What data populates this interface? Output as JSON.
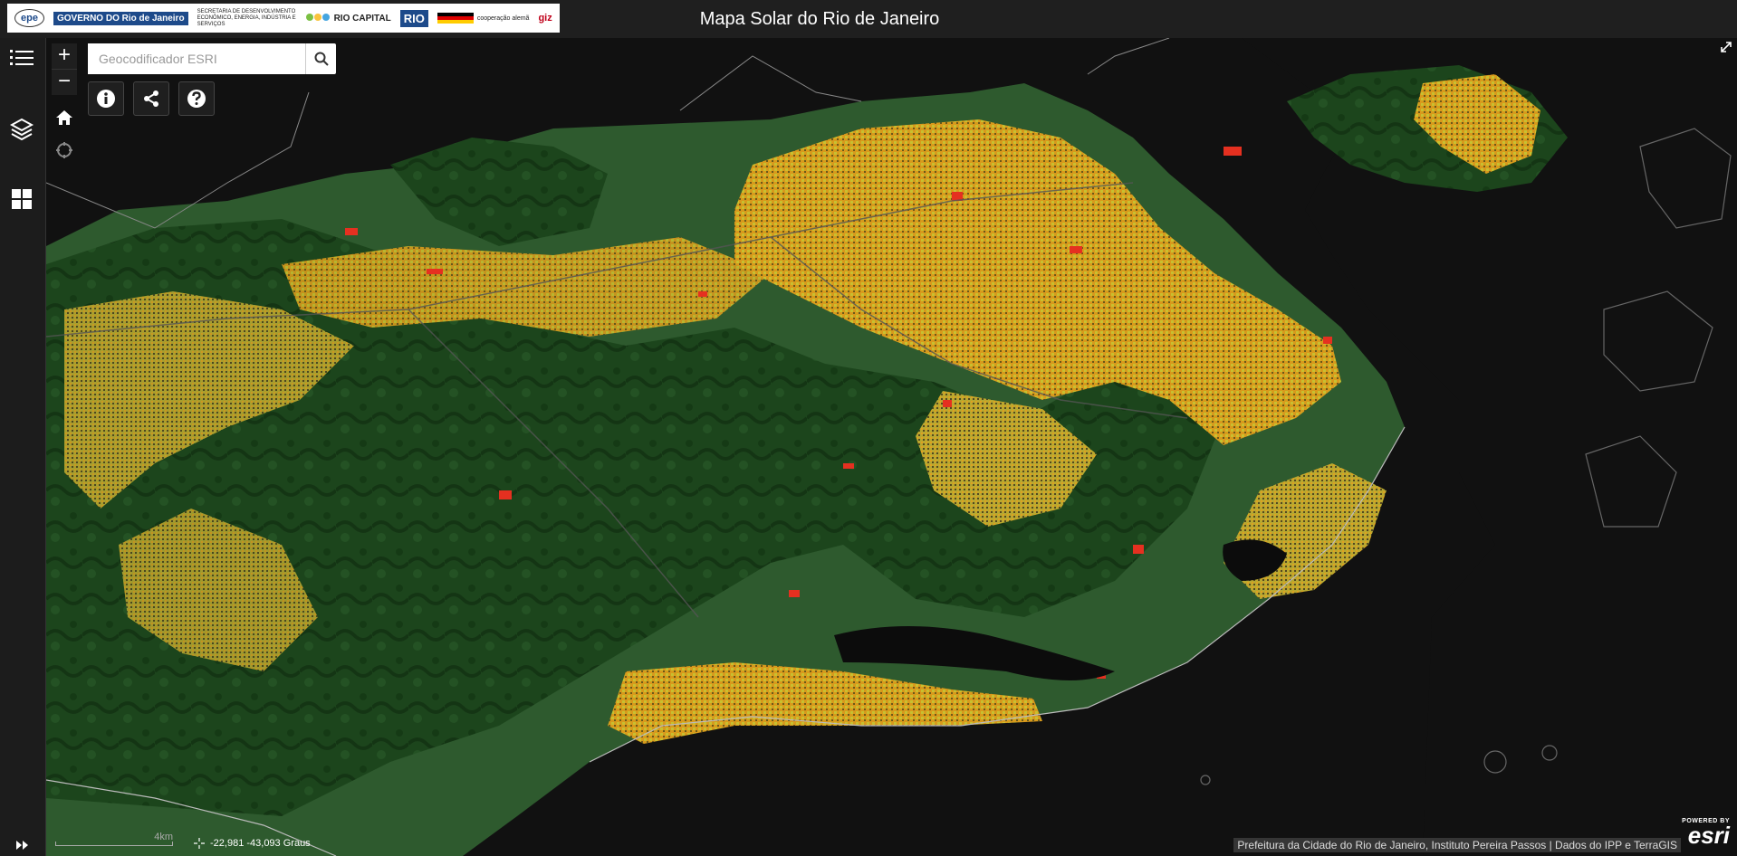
{
  "header": {
    "title": "Mapa Solar do Rio de Janeiro",
    "logos": [
      {
        "name": "epe-logo",
        "text": "epe"
      },
      {
        "name": "governo-rio-logo",
        "text": "GOVERNO DO Rio de Janeiro"
      },
      {
        "name": "secretaria-logo",
        "text": "SECRETARIA DE DESENVOLVIMENTO ECONÔMICO, ENERGIA, INDÚSTRIA E SERVIÇOS"
      },
      {
        "name": "rio-capital-logo",
        "text": "RIO CAPITAL"
      },
      {
        "name": "rio-prefeitura-logo",
        "text": "RIO"
      },
      {
        "name": "cooperacao-alema-logo",
        "text": "cooperação alemã"
      },
      {
        "name": "giz-logo",
        "text": "giz"
      }
    ]
  },
  "sidebar": {
    "items": [
      {
        "name": "legend-button",
        "icon": "list-icon"
      },
      {
        "name": "layers-button",
        "icon": "layers-icon"
      },
      {
        "name": "basemap-gallery-button",
        "icon": "grid-icon"
      }
    ]
  },
  "map": {
    "zoom_in": "+",
    "zoom_out": "−",
    "search": {
      "placeholder": "Geocodificador ESRI",
      "value": ""
    },
    "tools": [
      {
        "name": "about-button",
        "icon": "info-icon"
      },
      {
        "name": "share-button",
        "icon": "share-icon"
      },
      {
        "name": "help-button",
        "icon": "question-icon"
      }
    ],
    "scale_label": "4km",
    "coordinates": "-22,981 -43,093 Graus",
    "attribution": "Prefeitura da Cidade do Rio de Janeiro, Instituto Pereira Passos | Dados do IPP e TerraGIS",
    "esri": {
      "powered": "POWERED BY",
      "name": "esri"
    }
  },
  "colors": {
    "background": "#121212",
    "forest": "#1e4a1e",
    "urban_high": "#e0a020",
    "urban_mid": "#c8c030",
    "urban_hot": "#e53020",
    "water": "#101010"
  }
}
